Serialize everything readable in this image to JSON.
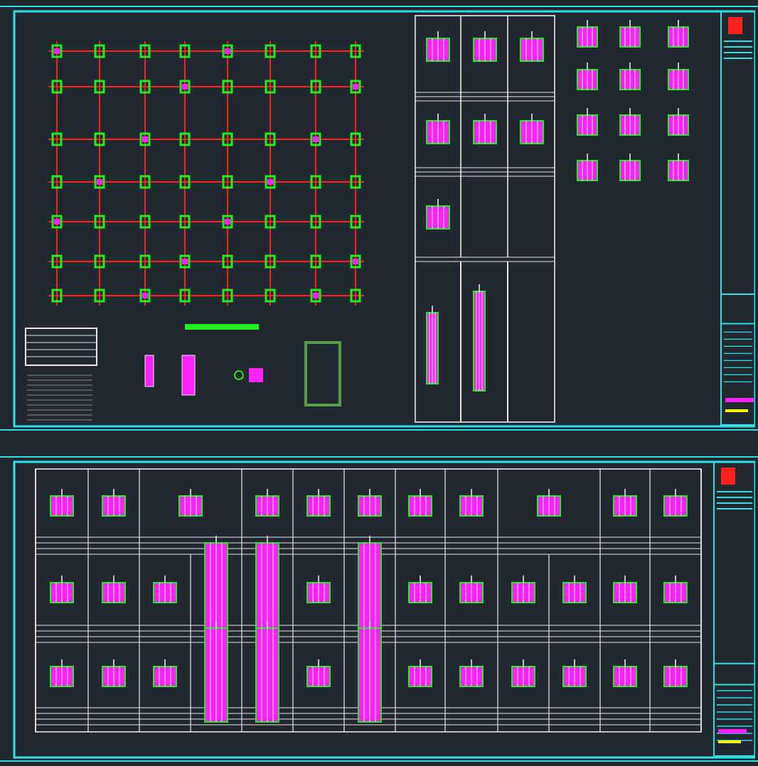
{
  "sheets": [
    {
      "kind": "plan"
    },
    {
      "kind": "schedule"
    }
  ]
}
